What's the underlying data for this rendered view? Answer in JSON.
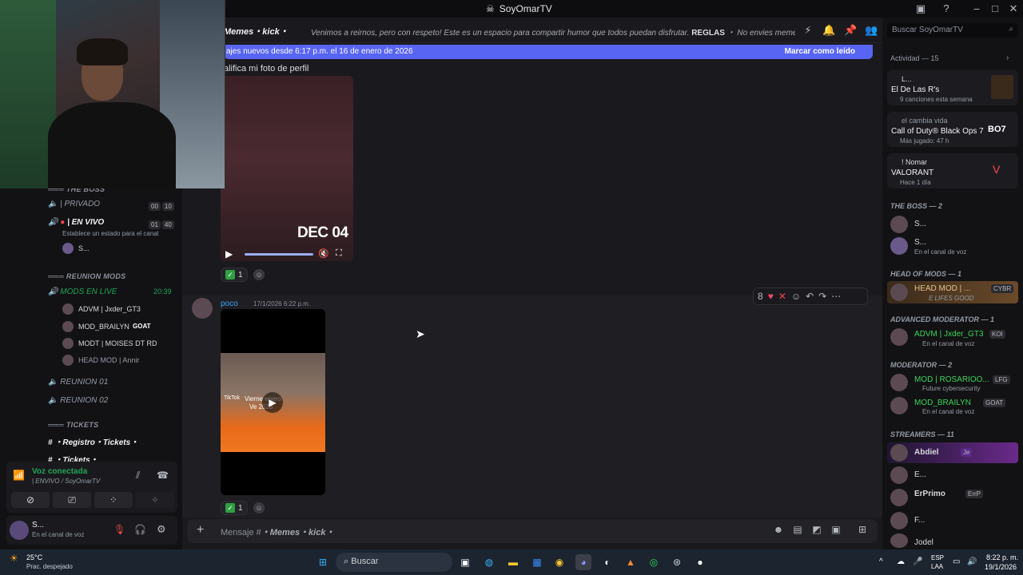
{
  "window": {
    "title": "SoyOmarTV"
  },
  "channel": {
    "name": "Memes・kick・",
    "topic_pre": "Venimos a reirnos, pero con respeto! Este es un espacio para compartir humor que todos puedan disfrutar.",
    "topic_bold": "REGLAS",
    "topic_post": " ・ No envies memes que conten...",
    "search_placeholder": "Buscar SoyOmarTV"
  },
  "new_messages": {
    "text": "ajes nuevos desde 6:17 p.m. el 16 de enero de 2026",
    "action": "Marcar como leído"
  },
  "messages": [
    {
      "text": "alifica mi foto de perfil",
      "video_date": "DEC 04",
      "reaction_count": "1"
    },
    {
      "author": "poco",
      "timestamp": "17/1/2026 6:22 p.m.",
      "reaction_count": "1",
      "video_caption_1": "Vierne  enero",
      "video_caption_2": "Ve    2026",
      "tiktok": "TikTok"
    }
  ],
  "toolbar": {
    "count": "8"
  },
  "composer": {
    "prefix": "Mensaje #",
    "channel": "・Memes・kick・"
  },
  "sidebar": {
    "cat_boss": "THE BOSS",
    "channels_top": [
      {
        "name": "| PRIVADO",
        "n1": "00",
        "n2": "10"
      },
      {
        "name": "| EN VIVO",
        "n1": "01",
        "n2": "40",
        "status": "Establece un estado para el canal"
      }
    ],
    "live_user": "S...",
    "cat_reunion": "REUNION MODS",
    "mods_live": "MODS EN LIVE",
    "mods_time": "20:39",
    "voice_users": [
      "ADVM | Jxder_GT3",
      "MOD_BRAILYN",
      "MODT | MOISES DT RD",
      "HEAD MOD | Annir"
    ],
    "goat": "GOAT",
    "reuniones": [
      "REUNION 01",
      "REUNION 02"
    ],
    "cat_tickets": "TICKETS",
    "tickets": [
      "・Registro・Tickets・",
      "・Tickets・"
    ],
    "voice_connected": "Voz conectada",
    "voice_channel": "| ENVIVO / SoyOmarTV",
    "user_name": "S...",
    "user_status": "En el canal de voz"
  },
  "right": {
    "activity_label": "Actividad — 15",
    "activities": [
      {
        "user": "L...",
        "title": "El De Las R's",
        "sub": "9 canciones esta semana"
      },
      {
        "user": "el cambia vida",
        "title": "Call of Duty® Black Ops 7",
        "sub": "Más jugado: 47 h",
        "badge": "BO7"
      },
      {
        "user": "! Nomar",
        "title": "VALORANT",
        "sub": "Hace 1 día"
      }
    ],
    "groups": [
      {
        "label": "THE BOSS — 2",
        "members": [
          {
            "name": "S...",
            "sub": ""
          },
          {
            "name": "S...",
            "sub": "En el canal de voz"
          }
        ]
      },
      {
        "label": "HEAD OF MODS — 1",
        "members": [
          {
            "name": "HEAD MOD | ...",
            "sub": "E LIFES GOOD",
            "tag": "CYBR"
          }
        ]
      },
      {
        "label": "ADVANCED MODERATOR — 1",
        "members": [
          {
            "name": "ADVM | Jxder_GT3",
            "sub": "En el canal de voz",
            "tag": "KOI"
          }
        ]
      },
      {
        "label": "MODERATOR — 2",
        "members": [
          {
            "name": "MOD | ROSARIOO...",
            "sub": "Future cybersecurity",
            "tag": "LFG"
          },
          {
            "name": "MOD_BRAILYN",
            "sub": "En el canal de voz",
            "tag": "GOAT"
          }
        ]
      },
      {
        "label": "STREAMERS — 11",
        "members": [
          {
            "name": "Abdiel",
            "sub": "",
            "tag": "Je"
          },
          {
            "name": "E...",
            "sub": ""
          },
          {
            "name": "ErPrimo",
            "sub": "",
            "tag": "ErrP"
          },
          {
            "name": "F...",
            "sub": ""
          },
          {
            "name": "Jodel",
            "sub": ""
          }
        ]
      }
    ]
  },
  "taskbar": {
    "weather_temp": "25°C",
    "weather_desc": "Prac. despejado",
    "search": "Buscar",
    "lang1": "ESP",
    "lang2": "LAA",
    "time": "8:22 p. m.",
    "date": "19/1/2026"
  }
}
